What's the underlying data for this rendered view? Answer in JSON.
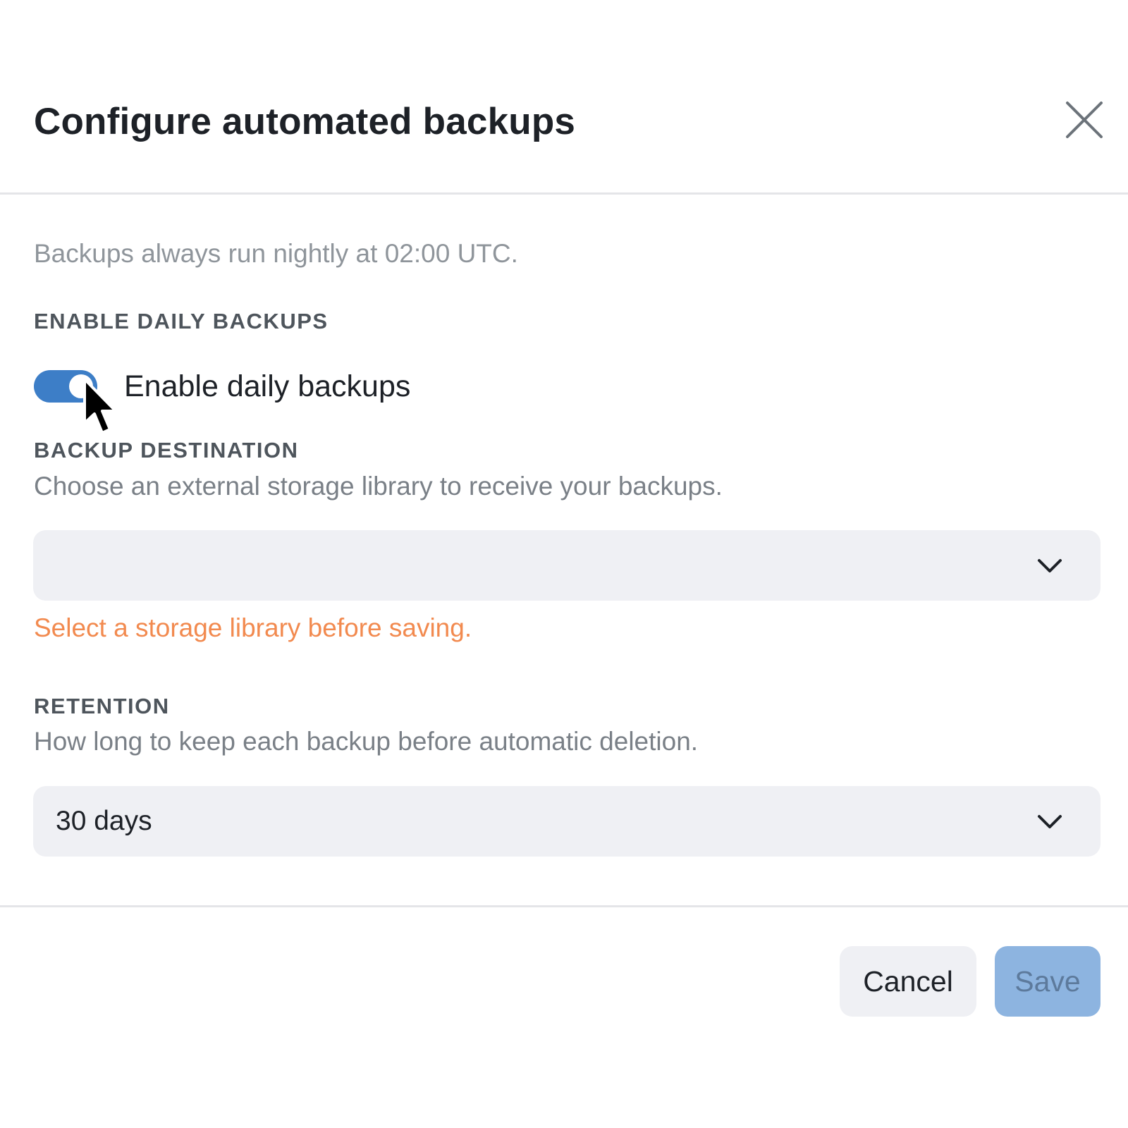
{
  "dialog": {
    "title": "Configure automated backups",
    "close_icon": "close-icon"
  },
  "schedule_note": "Backups always run nightly at 02:00 UTC.",
  "daily_backups": {
    "section_label": "ENABLE DAILY BACKUPS",
    "toggle_label": "Enable daily backups",
    "enabled": true
  },
  "destination": {
    "section_label": "BACKUP DESTINATION",
    "help": "Choose an external storage library to receive your backups.",
    "selected_value": "",
    "error": "Select a storage library before saving."
  },
  "retention": {
    "section_label": "RETENTION",
    "help": "How long to keep each backup before automatic deletion.",
    "selected_value": "30 days"
  },
  "footer": {
    "cancel_label": "Cancel",
    "save_label": "Save"
  },
  "colors": {
    "toggle_on": "#3d7ec7",
    "error": "#f28a4f",
    "save_disabled_bg": "#8db4e0",
    "field_bg": "#eff0f4"
  }
}
